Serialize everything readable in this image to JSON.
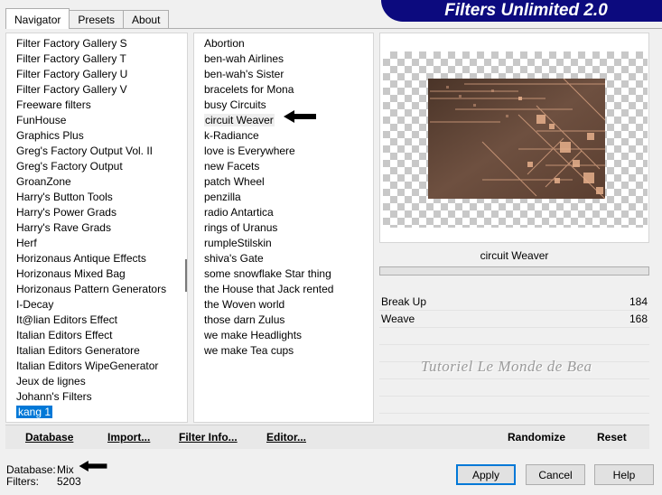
{
  "tabs": [
    {
      "label": "Navigator",
      "active": true
    },
    {
      "label": "Presets",
      "active": false
    },
    {
      "label": "About",
      "active": false
    }
  ],
  "banner": {
    "title": "Filters Unlimited 2.0"
  },
  "categories": {
    "items": [
      "Filter Factory Gallery S",
      "Filter Factory Gallery T",
      "Filter Factory Gallery U",
      "Filter Factory Gallery V",
      "Freeware filters",
      "FunHouse",
      "Graphics Plus",
      "Greg's Factory Output Vol. II",
      "Greg's Factory Output",
      "GroanZone",
      "Harry's Button Tools",
      "Harry's Power Grads",
      "Harry's Rave Grads",
      "Herf",
      "Horizonaus Antique Effects",
      "Horizonaus Mixed Bag",
      "Horizonaus Pattern Generators",
      "I-Decay",
      "It@lian Editors Effect",
      "Italian Editors Effect",
      "Italian Editors Generatore",
      "Italian Editors WipeGenerator",
      "Jeux de lignes",
      "Johann's Filters",
      "kang 1"
    ],
    "selected": "kang 1"
  },
  "filters": {
    "items": [
      "Abortion",
      "ben-wah Airlines",
      "ben-wah's Sister",
      "bracelets for Mona",
      "busy Circuits",
      "circuit Weaver",
      "k-Radiance",
      "love is Everywhere",
      "new Facets",
      "patch Wheel",
      "penzilla",
      "radio Antartica",
      "rings of Uranus",
      "rumpleStilskin",
      "shiva's Gate",
      "some snowflake Star thing",
      "the House that Jack rented",
      "the Woven world",
      "those darn Zulus",
      "we make Headlights",
      "we make Tea cups"
    ],
    "selected": "circuit Weaver"
  },
  "preview": {
    "filter_name": "circuit Weaver"
  },
  "params": [
    {
      "label": "Break Up",
      "value": "184"
    },
    {
      "label": "Weave",
      "value": "168"
    }
  ],
  "watermark": "Tutoriel Le Monde de Bea",
  "buttons": {
    "database": "Database",
    "import": "Import...",
    "filter_info": "Filter Info...",
    "editor": "Editor...",
    "randomize": "Randomize",
    "reset": "Reset",
    "apply": "Apply",
    "cancel": "Cancel",
    "help": "Help"
  },
  "status": {
    "database_label": "Database:",
    "database_value": "Mix",
    "filters_label": "Filters:",
    "filters_value": "5203"
  },
  "colors": {
    "banner": "#0c0a7e",
    "selection": "#0078d7",
    "image_base": "#6a4a3a",
    "image_highlight": "#e0a987"
  }
}
